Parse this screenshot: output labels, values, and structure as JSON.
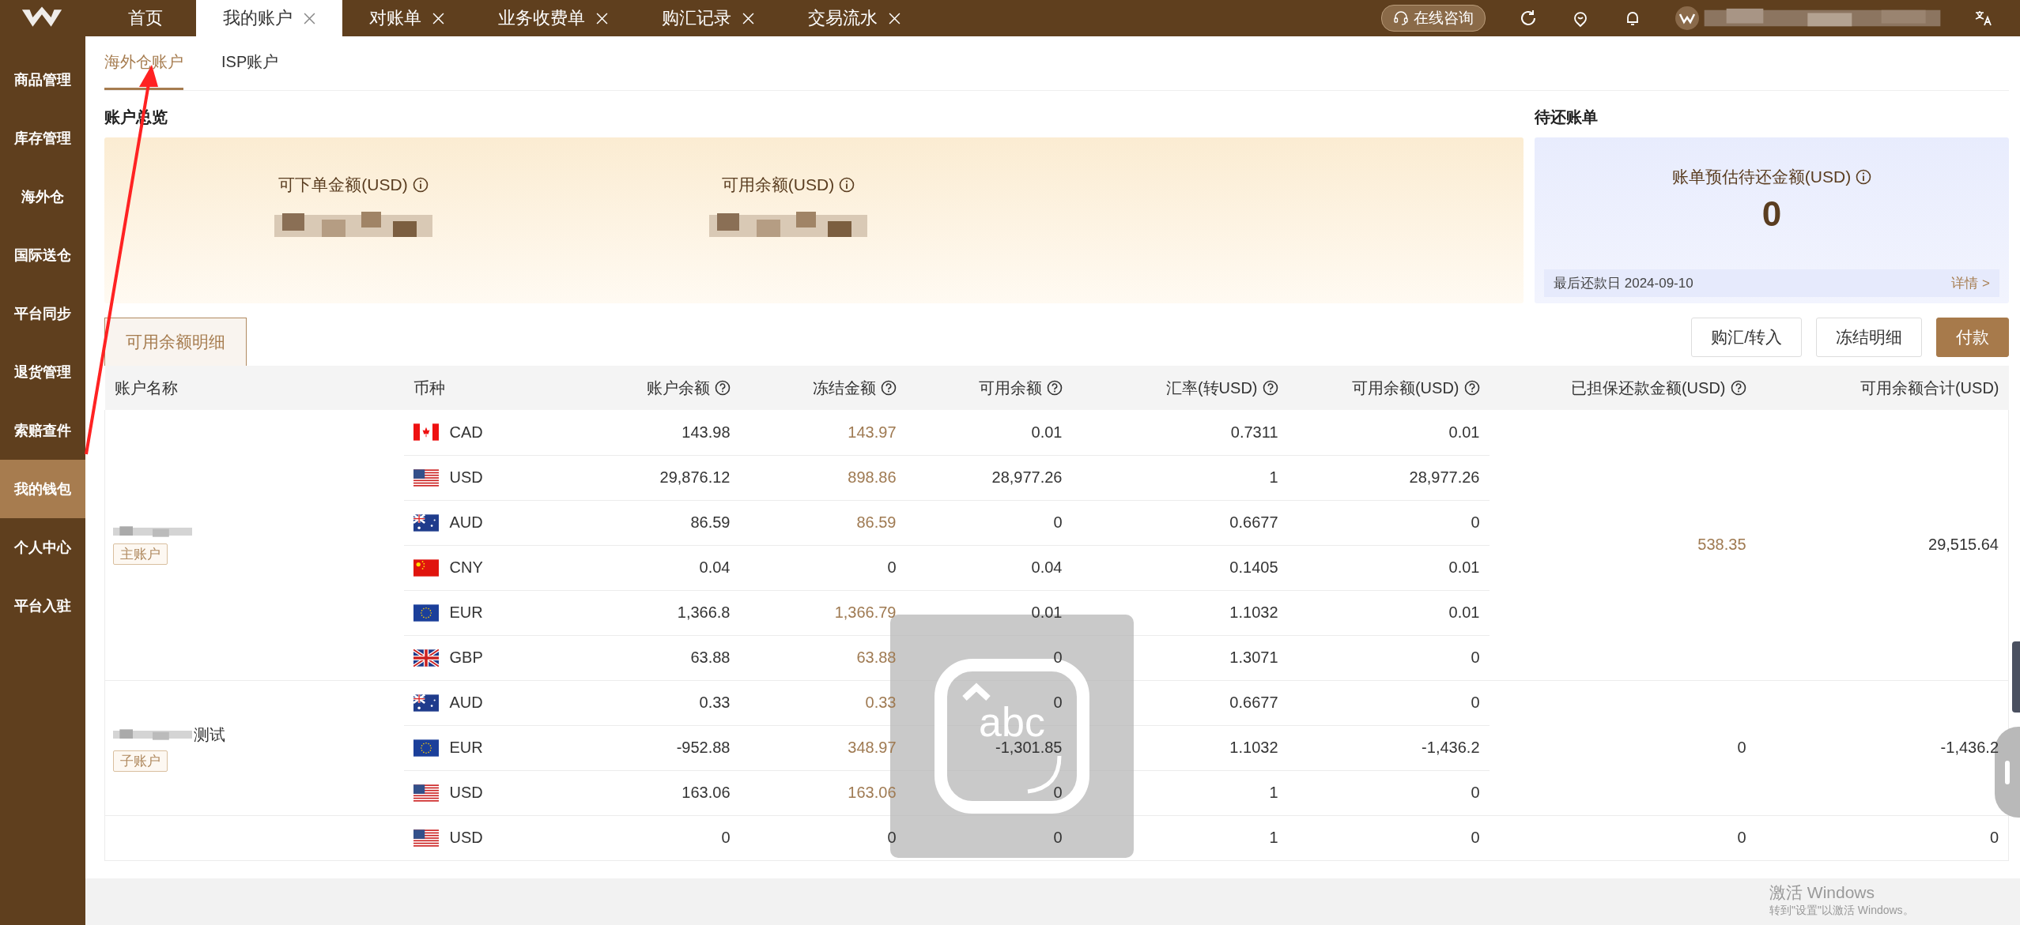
{
  "top_tabs": [
    {
      "label": "首页",
      "selected": false,
      "closable": false
    },
    {
      "label": "我的账户",
      "selected": true,
      "closable": true
    },
    {
      "label": "对账单",
      "selected": false,
      "closable": true
    },
    {
      "label": "业务收费单",
      "selected": false,
      "closable": true
    },
    {
      "label": "购汇记录",
      "selected": false,
      "closable": true
    },
    {
      "label": "交易流水",
      "selected": false,
      "closable": true
    }
  ],
  "consult_button": "在线咨询",
  "sidebar": {
    "items": [
      {
        "label": "商品管理",
        "selected": false
      },
      {
        "label": "库存管理",
        "selected": false
      },
      {
        "label": "海外仓",
        "selected": false
      },
      {
        "label": "国际送仓",
        "selected": false
      },
      {
        "label": "平台同步",
        "selected": false
      },
      {
        "label": "退货管理",
        "selected": false
      },
      {
        "label": "索赔查件",
        "selected": false
      },
      {
        "label": "我的钱包",
        "selected": true
      },
      {
        "label": "个人中心",
        "selected": false
      },
      {
        "label": "平台入驻",
        "selected": false
      }
    ]
  },
  "sub_tabs": [
    {
      "label": "海外仓账户",
      "selected": true
    },
    {
      "label": "ISP账户",
      "selected": false
    }
  ],
  "overview": {
    "title": "账户总览",
    "items": [
      {
        "label": "可下单金额(USD)"
      },
      {
        "label": "可用余额(USD)"
      }
    ]
  },
  "pending_bill": {
    "title": "待还账单",
    "label": "账单预估待还金额(USD)",
    "amount": "0",
    "due": "最后还款日 2024-09-10",
    "link": "详情 >"
  },
  "detail_tab": {
    "label": "可用余额明细",
    "selected": true
  },
  "buttons": [
    {
      "label": "购汇/转入",
      "kind": "outline"
    },
    {
      "label": "冻结明细",
      "kind": "outline"
    },
    {
      "label": "付款",
      "kind": "primary"
    }
  ],
  "table": {
    "columns": [
      {
        "label": "账户名称",
        "help": false
      },
      {
        "label": "币种",
        "help": false
      },
      {
        "label": "账户余额",
        "help": true
      },
      {
        "label": "冻结金额",
        "help": true
      },
      {
        "label": "可用余额",
        "help": true
      },
      {
        "label": "汇率(转USD)",
        "help": true
      },
      {
        "label": "可用余额(USD)",
        "help": true
      },
      {
        "label": "已担保还款金额(USD)",
        "help": true
      },
      {
        "label": "可用余额合计(USD)",
        "help": false
      }
    ],
    "accounts": [
      {
        "redacted": true,
        "badge": "主账户",
        "guaranteed": "538.35",
        "guaranteed_highlight": true,
        "total": "29,515.64",
        "rows": [
          {
            "kind": "ca",
            "currency": "CAD",
            "balance": "143.98",
            "frozen": "143.97",
            "frozen_highlight": true,
            "available": "0.01",
            "rate": "0.7311",
            "available_usd": "0.01"
          },
          {
            "kind": "us",
            "currency": "USD",
            "balance": "29,876.12",
            "frozen": "898.86",
            "frozen_highlight": true,
            "available": "28,977.26",
            "rate": "1",
            "available_usd": "28,977.26"
          },
          {
            "kind": "au",
            "currency": "AUD",
            "balance": "86.59",
            "frozen": "86.59",
            "frozen_highlight": true,
            "available": "0",
            "rate": "0.6677",
            "available_usd": "0"
          },
          {
            "kind": "cn",
            "currency": "CNY",
            "balance": "0.04",
            "frozen": "0",
            "frozen_highlight": false,
            "available": "0.04",
            "rate": "0.1405",
            "available_usd": "0.01"
          },
          {
            "kind": "eu",
            "currency": "EUR",
            "balance": "1,366.8",
            "frozen": "1,366.79",
            "frozen_highlight": true,
            "available": "0.01",
            "rate": "1.1032",
            "available_usd": "0.01"
          },
          {
            "kind": "gb",
            "currency": "GBP",
            "balance": "63.88",
            "frozen": "63.88",
            "frozen_highlight": true,
            "available": "0",
            "rate": "1.3071",
            "available_usd": "0"
          }
        ]
      },
      {
        "name": "测试",
        "redacted": true,
        "badge": "子账户",
        "guaranteed": "0",
        "guaranteed_highlight": false,
        "total": "-1,436.2",
        "rows": [
          {
            "kind": "au",
            "currency": "AUD",
            "balance": "0.33",
            "frozen": "0.33",
            "frozen_highlight": true,
            "available": "0",
            "rate": "0.6677",
            "available_usd": "0"
          },
          {
            "kind": "eu",
            "currency": "EUR",
            "balance": "-952.88",
            "frozen": "348.97",
            "frozen_highlight": true,
            "available": "-1,301.85",
            "rate": "1.1032",
            "available_usd": "-1,436.2"
          },
          {
            "kind": "us",
            "currency": "USD",
            "balance": "163.06",
            "frozen": "163.06",
            "frozen_highlight": true,
            "available": "0",
            "rate": "1",
            "available_usd": "0"
          }
        ]
      },
      {
        "redacted": false,
        "guaranteed": "0",
        "guaranteed_highlight": false,
        "total": "0",
        "rows": [
          {
            "kind": "us",
            "currency": "USD",
            "balance": "0",
            "frozen": "0",
            "frozen_highlight": false,
            "available": "0",
            "rate": "1",
            "available_usd": "0"
          }
        ]
      }
    ]
  },
  "keyboard_overlay": {
    "label": "abc"
  },
  "os_notice": {
    "title": "激活 Windows",
    "text": "转到\"设置\"以激活 Windows。"
  }
}
